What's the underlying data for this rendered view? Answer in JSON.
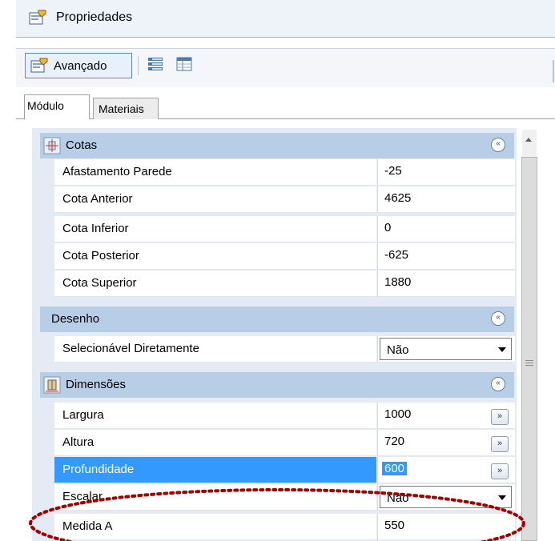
{
  "window": {
    "title": "Propriedades",
    "title_icon": "properties-icon"
  },
  "toolbar": {
    "advanced_label": "Avançado",
    "advanced_icon": "properties-icon",
    "categorized_icon": "categorized-view-icon",
    "grid_icon": "table-view-icon"
  },
  "tabs": [
    {
      "label": "Módulo",
      "active": true
    },
    {
      "label": "Materiais",
      "active": false
    }
  ],
  "categories": {
    "cotas": {
      "label": "Cotas",
      "rows": [
        {
          "name": "Afastamento Parede",
          "value": "-25"
        },
        {
          "name": "Cota Anterior",
          "value": "4625"
        },
        {
          "name": "Cota Inferior",
          "value": "0"
        },
        {
          "name": "Cota Posterior",
          "value": "-625"
        },
        {
          "name": "Cota Superior",
          "value": "1880"
        }
      ]
    },
    "desenho": {
      "label": "Desenho",
      "rows": [
        {
          "name": "Selecionável Diretamente",
          "value": "Não"
        }
      ]
    },
    "dimensoes": {
      "label": "Dimensões",
      "rows": [
        {
          "name": "Largura",
          "value": "1000"
        },
        {
          "name": "Altura",
          "value": "720"
        },
        {
          "name": "Profundidade",
          "value": "600"
        },
        {
          "name": "Escalar",
          "value": "Não"
        },
        {
          "name": "Medida A",
          "value": "550"
        }
      ]
    }
  },
  "controls": {
    "collapse_symbol": "«",
    "ellipsis_symbol": "»"
  },
  "colors": {
    "selection": "#3399ff",
    "category_band": "#b8cde6",
    "annotation": "#a00000"
  }
}
